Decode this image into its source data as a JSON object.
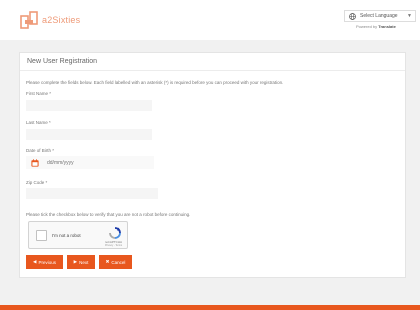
{
  "header": {
    "logo_text": "a2Sixties",
    "language_label": "Select Language",
    "language_caret": "▼",
    "powered_prefix": "Powered by",
    "powered_brand": "Translate"
  },
  "panel": {
    "title": "New User Registration",
    "intro": "Please complete the fields below. Each field labelled with an asterisk (*) is required before you can proceed with your registration.",
    "fields": {
      "first_name": {
        "label": "First Name *",
        "value": ""
      },
      "last_name": {
        "label": "Last Name *",
        "value": ""
      },
      "dob": {
        "label": "Date of Birth *",
        "placeholder": "dd/mm/yyyy"
      },
      "zip": {
        "label": "Zip Code *",
        "value": ""
      }
    },
    "captcha_note": "Please tick the checkbox below to verify that you are not a robot before continuing.",
    "recaptcha": {
      "label": "I'm not a robot",
      "brand": "reCAPTCHA",
      "terms": "Privacy - Terms"
    },
    "buttons": {
      "previous": "Previous",
      "next": "Next",
      "cancel": "Cancel"
    }
  },
  "colors": {
    "accent": "#e8571e",
    "logo": "#ee9a78"
  }
}
